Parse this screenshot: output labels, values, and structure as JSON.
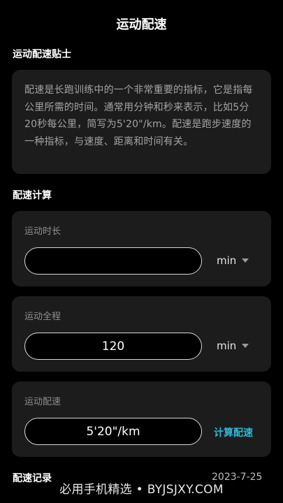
{
  "header": {
    "title": "运动配速"
  },
  "tips": {
    "heading": "运动配速贴士",
    "text": "配速是长跑训练中的一个非常重要的指标，它是指每公里所需的时间。通常用分钟和秒来表示，比如5分20秒每公里，简写为5'20\"/km。配速是跑步速度的一种指标，与速度、距离和时间有关。"
  },
  "calculator": {
    "heading": "配速计算",
    "duration": {
      "label": "运动时长",
      "value": "",
      "unit": "min"
    },
    "distance": {
      "label": "运动全程",
      "value": "120",
      "unit": "min"
    },
    "pace": {
      "label": "运动配速",
      "value": "5'20\"/km",
      "button_label": "计算配速"
    }
  },
  "records": {
    "heading": "配速记录"
  },
  "watermark": {
    "date": "2023-7-25",
    "text": "必用手机精选 • BYJSJXY.COM"
  }
}
